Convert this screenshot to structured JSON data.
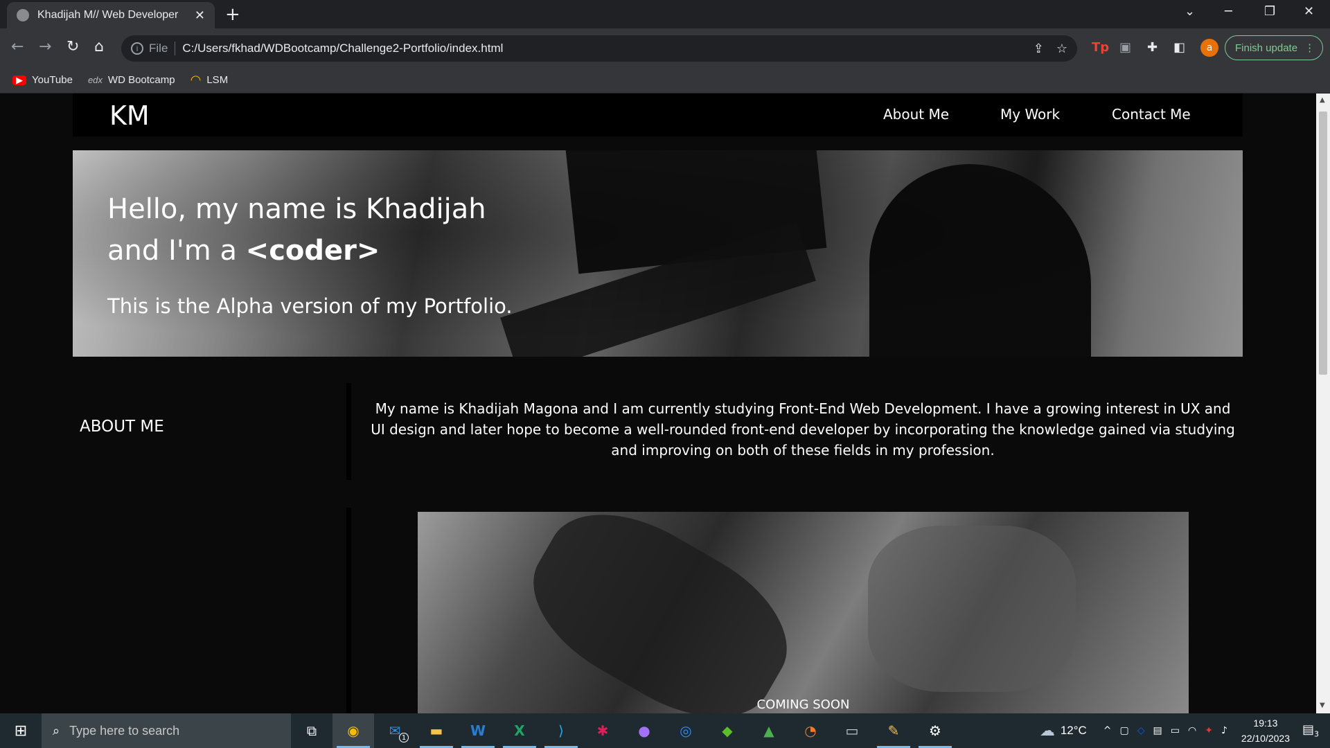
{
  "browser": {
    "tab_title": "Khadijah M// Web Developer",
    "tab_close": "✕",
    "new_tab": "+",
    "url_scheme": "File",
    "url": "C:/Users/fkhad/WDBootcamp/Challenge2-Portfolio/index.html",
    "avatar_letter": "a",
    "update_label": "Finish update",
    "bookmarks": [
      {
        "label": "YouTube"
      },
      {
        "label": "WD Bootcamp"
      },
      {
        "label": "LSM"
      }
    ]
  },
  "site": {
    "logo": "KM",
    "nav": [
      "About Me",
      "My Work",
      "Contact Me"
    ],
    "hero": {
      "line1": "Hello, my name is Khadijah",
      "line2_prefix": "and I'm a ",
      "line2_bold": "<coder>",
      "subtitle": "This is the Alpha version of my Portfolio."
    },
    "about": {
      "label": "ABOUT ME",
      "text": "My name is Khadijah Magona and I am currently studying Front-End Web Development. I have a growing interest in UX and UI design and later hope to become a well-rounded front-end developer by incorporating the knowledge gained via studying and improving on both of these fields in my profession."
    },
    "work": {
      "caption": "COMING SOON"
    }
  },
  "taskbar": {
    "search_placeholder": "Type here to search",
    "mail_badge": "1",
    "weather": "12°C",
    "time": "19:13",
    "date": "22/10/2023",
    "notif_count": "3"
  },
  "colors": {
    "page_bg": "#0a0a0a",
    "nav_bg": "#000000",
    "update_accent": "#81c995",
    "avatar": "#e8710a"
  }
}
